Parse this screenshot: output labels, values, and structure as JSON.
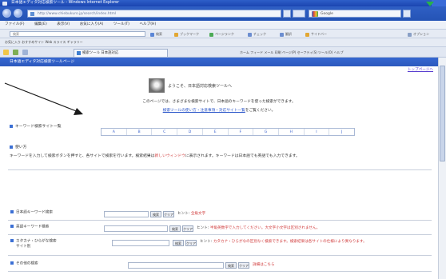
{
  "window": {
    "title": "日本語エディタ対応検索ツール - Windows Internet Explorer"
  },
  "navbar": {
    "address": "http://www.chiebukuro.jp/search/index.html",
    "search_placeholder": "Google"
  },
  "menu": [
    "ファイル(F)",
    "編集(E)",
    "表示(V)",
    "お気に入り(A)",
    "ツール(T)",
    "ヘルプ(H)"
  ],
  "toolbar1": {
    "input_text": "検索",
    "items": [
      "検索",
      "ブックマーク",
      "ページランク",
      "チェック",
      "翻訳",
      "サイドバー",
      "オプション"
    ]
  },
  "toolbar2": {
    "left_text": "お気に入り  おすすめサイト  Web スライス ギャラリー",
    "right_text": "ホーム  フィード  メール  印刷  ページ(P)  セーフティ(S)  ツール(O)  ヘルプ"
  },
  "tab": {
    "label": "検索ツール 日本語対応"
  },
  "page": {
    "header": "日本語エディタ対応検索ツールページ",
    "top_link": "トップページへ",
    "intro": "ようこそ、日本語対応検索ツールへ",
    "line1": "このページでは、さまざまな検索サイトで、日本語のキーワードを使った検索ができます。",
    "line2_link": "検索ツールの使い方・注意事項・対応サイト一覧",
    "line2_tail": "をご覧ください。",
    "section1": "キーワード検索サイト一覧",
    "links": [
      "A",
      "B",
      "C",
      "D",
      "E",
      "F",
      "G",
      "H",
      "I",
      "J"
    ],
    "section2": "使い方",
    "para_normal": "キーワードを入力して検索ボタンを押すと、各サイトで検索を行います。検索結果は",
    "para_red": "新しいウィンドウ",
    "para_tail": "に表示されます。キーワードは日本語でも英語でも入力できます。"
  },
  "forms": [
    {
      "label": "日本語キーワード検索",
      "btn1": "検索",
      "btn2": "クリア",
      "note": "ヒント:",
      "note_red": "全角文字"
    },
    {
      "label": "英語キーワード検索",
      "btn1": "検索",
      "btn2": "クリア",
      "note": "ヒント:",
      "note_red": "半角英数字で入力してください。大文字小文字は区別されません。"
    },
    {
      "label": "カタカナ・ひらがな検索",
      "label2": "サイト別",
      "btn1": "検索",
      "btn2": "クリア",
      "note": "ヒント:",
      "note_red": "カタカナ・ひらがなの区別なく検索できます。検索結果は各サイトの仕様により異なります。"
    },
    {
      "label": "その他の検索",
      "btn1": "検索",
      "btn2": "クリア",
      "note_red": "詳細はこちら"
    }
  ],
  "colors": {
    "header_blue": "#2c58bd",
    "link_blue": "#2a55c9",
    "accent_red": "#d03a3a"
  }
}
